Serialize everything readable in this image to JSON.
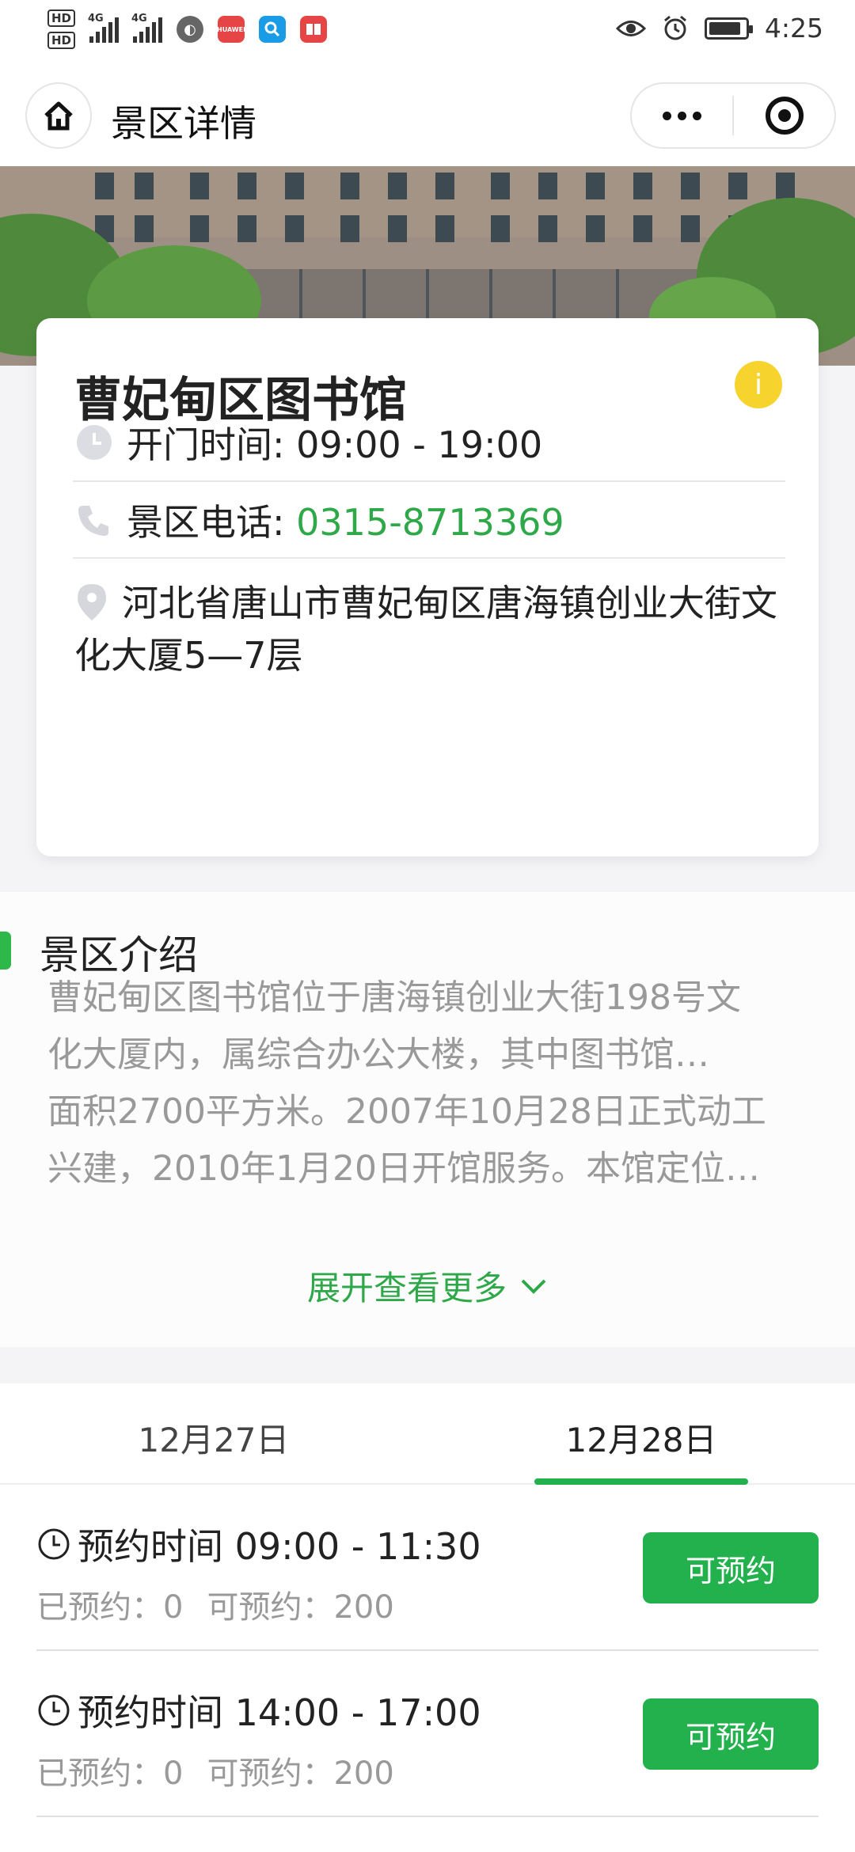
{
  "status_bar": {
    "hd1": "HD",
    "hd2": "HD",
    "net1": "4G",
    "net2": "4G",
    "huawei_label": "HUAWEI",
    "time": "4:25",
    "battery_level": 0.9
  },
  "nav": {
    "title": "景区详情"
  },
  "card": {
    "title": "曹妃甸区图书馆",
    "info_glyph": "i",
    "hours_label": "开门时间: ",
    "hours_value": "09:00 - 19:00",
    "phone_label": "景区电话: ",
    "phone_value": "0315-8713369",
    "address": "河北省唐山市曹妃甸区唐海镇创业大街文化大厦5—7层"
  },
  "intro": {
    "title": "景区介绍",
    "text": "曹妃甸区图书馆位于唐海镇创业大街198号文化大厦内，属综合办公大楼，其中图书馆…面积2700平方米。2007年10月28日正式动工兴建，2010年1月20日开馆服务。本馆定位…",
    "line1": "曹妃甸区图书馆位于唐海镇创业大街198号文",
    "line2": "化大厦内，属综合办公大楼，其中图书馆…",
    "line3": "面积2700平方米。2007年10月28日正式动工",
    "line4": "兴建，2010年1月20日开馆服务。本馆定位…",
    "more_label": "展开查看更多"
  },
  "tabs": [
    {
      "label": "12月27日"
    },
    {
      "label": "12月28日"
    }
  ],
  "slots": [
    {
      "time": "预约时间 09:00 - 11:30",
      "booked_label": "已预约：0",
      "available_label": "可预约：200",
      "button": "可预约"
    },
    {
      "time": "预约时间 14:00 - 17:00",
      "booked_label": "已预约：0",
      "available_label": "可预约：200",
      "button": "可预约"
    }
  ],
  "colors": {
    "accent_green": "#22b14c",
    "phone_green": "#2fa84a",
    "info_yellow": "#f6d32d"
  }
}
